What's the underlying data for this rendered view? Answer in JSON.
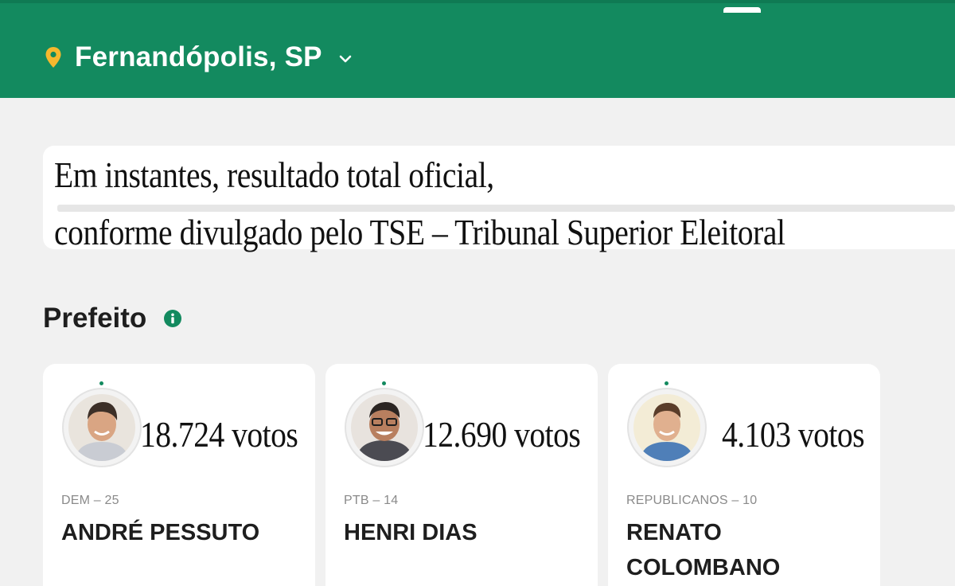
{
  "header": {
    "location": "Fernandópolis, SP",
    "location_icon": "map-pin-icon",
    "dropdown_icon": "chevron-down-icon",
    "accent_color": "#138a5f",
    "pin_color": "#f5b82e"
  },
  "notice": {
    "line1": "Em instantes, resultado total oficial,",
    "line2": "conforme divulgado pelo TSE – Tribunal Superior Eleitoral"
  },
  "section": {
    "title": "Prefeito",
    "info_icon": "info-icon"
  },
  "candidates": [
    {
      "votes": "18.724 votos",
      "party": "DEM – 25",
      "name": "ANDRÉ PESSUTO"
    },
    {
      "votes": "12.690 votos",
      "party": "PTB – 14",
      "name": "HENRI DIAS"
    },
    {
      "votes": "4.103 votos",
      "party": "REPUBLICANOS – 10",
      "name": "RENATO COLOMBANO"
    }
  ]
}
